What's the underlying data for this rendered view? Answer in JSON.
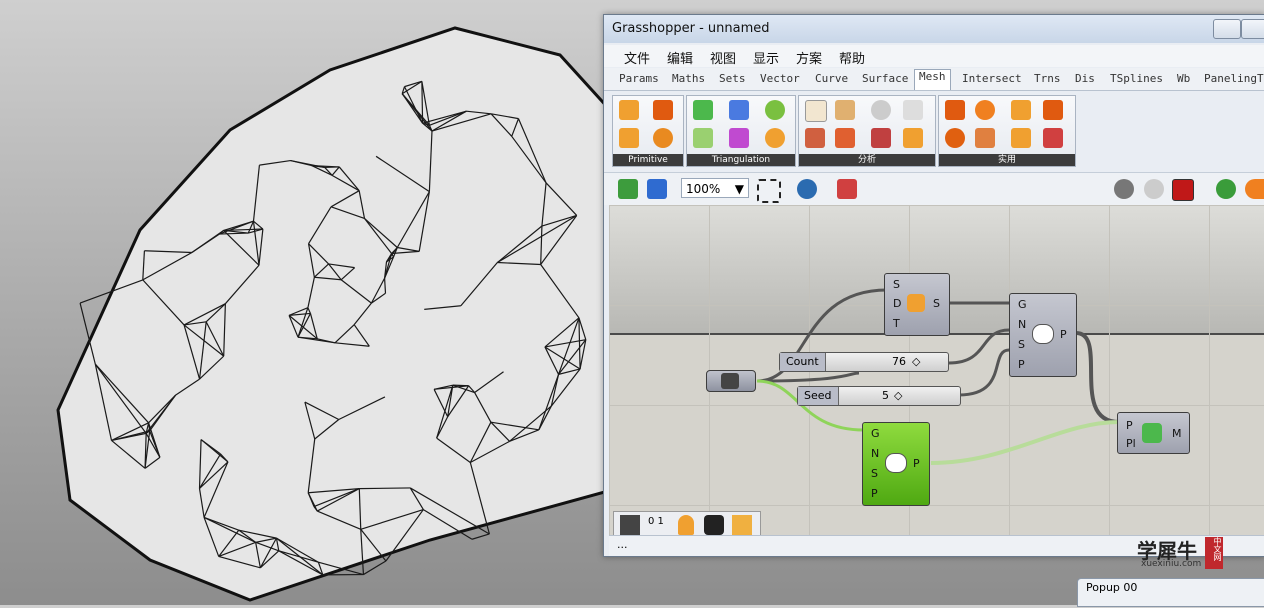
{
  "window": {
    "title": "Grasshopper - unnamed"
  },
  "menu": [
    "文件",
    "编辑",
    "视图",
    "显示",
    "方案",
    "帮助"
  ],
  "tabs": [
    "Params",
    "Maths",
    "Sets",
    "Vector",
    "Curve",
    "Surface",
    "Mesh",
    "Intersect",
    "Trns",
    "Dis",
    "TSplines",
    "Wb",
    "PanelingTo"
  ],
  "active_tab": "Mesh",
  "groups": [
    "Primitive",
    "Triangulation",
    "分析",
    "实用"
  ],
  "zoom": "100%",
  "canvas": {
    "sliders": [
      {
        "label": "Count",
        "value": "76"
      },
      {
        "label": "Seed",
        "value": "5"
      }
    ],
    "populate_top": {
      "inputs": [
        "G",
        "N",
        "S",
        "P"
      ],
      "output": "P"
    },
    "populate_bottom": {
      "inputs": [
        "G",
        "N",
        "S",
        "P"
      ],
      "output": "P"
    },
    "surface_split": {
      "inputs": [
        "S",
        "D",
        "T"
      ],
      "output": "S"
    },
    "mesh_component": {
      "inputs": [
        "P",
        "Pl"
      ],
      "output": "M"
    },
    "bottom_tools": [
      "0 1"
    ]
  },
  "status": "...",
  "popup": {
    "title": "Popup 00"
  },
  "watermark": {
    "title": "学犀牛",
    "badge": "中文网",
    "url": "xuexiniu.com"
  },
  "colors": {
    "accent_green": "#5cbf1a",
    "component_grey": "#a8abb8",
    "canvas": "#d5d3cc"
  }
}
